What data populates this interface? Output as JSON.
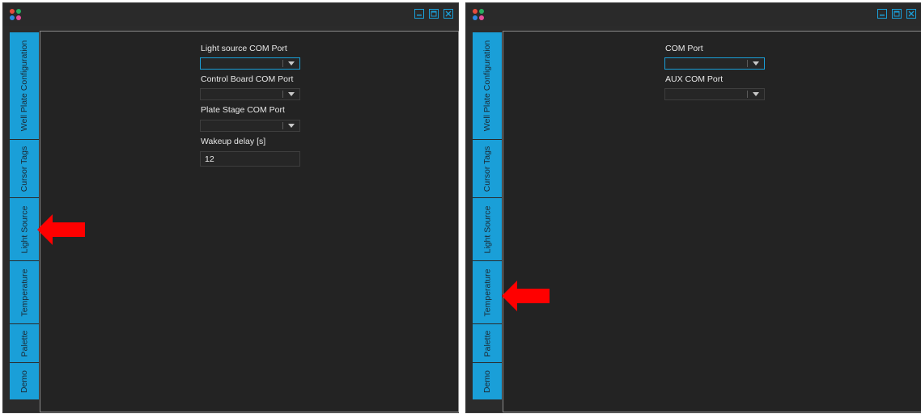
{
  "colors": {
    "accent": "#1a9fd8",
    "background": "#2b2b2b",
    "arrow": "#ff0000"
  },
  "left": {
    "tabs": [
      {
        "label": "Well Plate Configuration"
      },
      {
        "label": "Cursor Tags"
      },
      {
        "label": "Light Source"
      },
      {
        "label": "Temperature"
      },
      {
        "label": "Palette"
      },
      {
        "label": "Demo"
      }
    ],
    "fields": {
      "light_source_com_label": "Light source COM Port",
      "light_source_com_value": "",
      "control_board_com_label": "Control Board COM Port",
      "control_board_com_value": "",
      "plate_stage_com_label": "Plate Stage COM Port",
      "plate_stage_com_value": "",
      "wakeup_delay_label": "Wakeup delay [s]",
      "wakeup_delay_value": "12"
    },
    "highlighted_tab": "Light Source"
  },
  "right": {
    "tabs": [
      {
        "label": "Well Plate Configuration"
      },
      {
        "label": "Cursor Tags"
      },
      {
        "label": "Light Source"
      },
      {
        "label": "Temperature"
      },
      {
        "label": "Palette"
      },
      {
        "label": "Demo"
      }
    ],
    "fields": {
      "com_port_label": "COM Port",
      "com_port_value": "",
      "aux_com_port_label": "AUX COM Port",
      "aux_com_port_value": ""
    },
    "highlighted_tab": "Temperature"
  },
  "icons": {
    "app_logo": "app-logo-icon",
    "minimize": "minimize-icon",
    "maximize": "maximize-icon",
    "close": "close-icon",
    "annotation_arrow": "red-arrow-icon"
  }
}
